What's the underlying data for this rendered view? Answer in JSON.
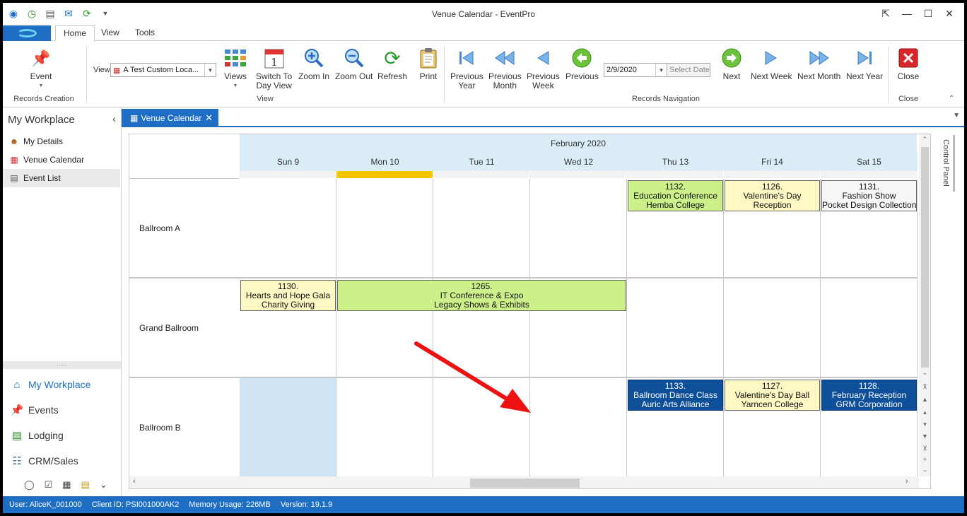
{
  "window": {
    "title": "Venue Calendar - EventPro"
  },
  "quick_access": [
    "eye-icon",
    "clock-icon",
    "document-icon",
    "mail-icon",
    "refresh-icon",
    "customize-icon"
  ],
  "ribbon": {
    "tabs": [
      "Home",
      "View",
      "Tools"
    ],
    "active_tab": "Home",
    "event_label": "Event",
    "records_creation_label": "Records Creation",
    "view_label": "View",
    "view_value": "A Test Custom Loca...",
    "views_label": "Views",
    "switch_label_1": "Switch To",
    "switch_label_2": "Day View",
    "zoom_in": "Zoom In",
    "zoom_out": "Zoom Out",
    "refresh": "Refresh",
    "print": "Print",
    "view_group_label": "View",
    "prev_year_1": "Previous",
    "prev_year_2": "Year",
    "prev_month_1": "Previous",
    "prev_month_2": "Month",
    "prev_week_1": "Previous",
    "prev_week_2": "Week",
    "previous": "Previous",
    "date_value": "2/9/2020",
    "select_date": "Select Date",
    "next": "Next",
    "next_week": "Next Week",
    "next_month": "Next Month",
    "next_year": "Next Year",
    "records_nav_label": "Records Navigation",
    "close": "Close",
    "close_group_label": "Close"
  },
  "left_panel": {
    "title": "My Workplace",
    "items": [
      {
        "label": "My Details",
        "icon": "user-icon"
      },
      {
        "label": "Venue Calendar",
        "icon": "calendar-icon"
      },
      {
        "label": "Event List",
        "icon": "list-icon"
      }
    ],
    "nav": [
      {
        "label": "My Workplace",
        "icon": "home-icon"
      },
      {
        "label": "Events",
        "icon": "pin-icon"
      },
      {
        "label": "Lodging",
        "icon": "lodging-icon"
      },
      {
        "label": "CRM/Sales",
        "icon": "crm-icon"
      }
    ]
  },
  "doc_tab": {
    "label": "Venue Calendar"
  },
  "calendar": {
    "month": "February 2020",
    "days": [
      "Sun 9",
      "Mon 10",
      "Tue 11",
      "Wed 12",
      "Thu 13",
      "Fri 14",
      "Sat 15"
    ],
    "today_index": 1,
    "rooms": [
      "Ballroom A",
      "Grand Ballroom",
      "Ballroom B"
    ],
    "events": [
      {
        "room": 0,
        "start": 4,
        "span": 1,
        "style": "green",
        "lines": [
          "1132.",
          "Education Conference",
          "Hemba College"
        ]
      },
      {
        "room": 0,
        "start": 5,
        "span": 1,
        "style": "yellow",
        "lines": [
          "1126.",
          "Valentine's Day",
          "Reception"
        ]
      },
      {
        "room": 0,
        "start": 6,
        "span": 1,
        "style": "white",
        "lines": [
          "1131.",
          "Fashion Show",
          "Pocket Design Collection"
        ]
      },
      {
        "room": 1,
        "start": 0,
        "span": 1,
        "style": "yellow",
        "lines": [
          "1130.",
          "Hearts and Hope Gala",
          "Charity Giving"
        ]
      },
      {
        "room": 1,
        "start": 1,
        "span": 3,
        "style": "green",
        "lines": [
          "1265.",
          "IT Conference & Expo",
          "Legacy Shows & Exhibits"
        ]
      },
      {
        "room": 2,
        "start": 4,
        "span": 1,
        "style": "blue",
        "lines": [
          "1133.",
          "Ballroom Dance Class",
          "Auric Arts Alliance"
        ]
      },
      {
        "room": 2,
        "start": 5,
        "span": 1,
        "style": "yellow",
        "lines": [
          "1127.",
          "Valentine's Day Ball",
          "Yarncen College"
        ]
      },
      {
        "room": 2,
        "start": 6,
        "span": 1,
        "style": "blue",
        "lines": [
          "1128.",
          "February Reception",
          "GRM Corporation"
        ]
      }
    ]
  },
  "control_panel_label": "Control Panel",
  "status": {
    "user": "User: AliceK_001000",
    "client": "Client ID: PSI001000AK2",
    "memory": "Memory Usage: 226MB",
    "version": "Version: 19.1.9"
  }
}
